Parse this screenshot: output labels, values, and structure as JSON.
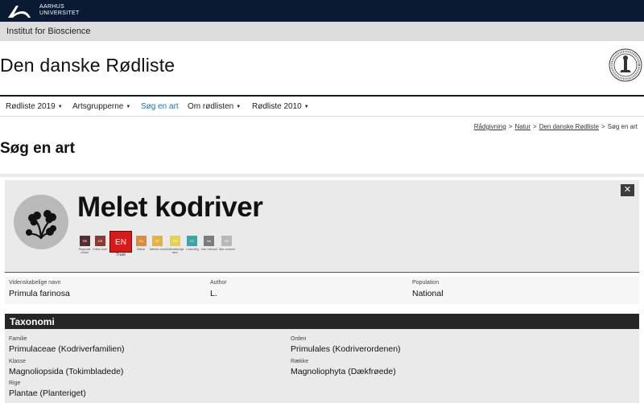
{
  "header": {
    "university_line1": "AARHUS",
    "university_line2": "UNIVERSITET",
    "institute": "Institut for Bioscience",
    "site_title": "Den danske Rødliste"
  },
  "nav": {
    "items": [
      {
        "label": "Rødliste 2019",
        "has_dropdown": true
      },
      {
        "label": "Artsgrupperne",
        "has_dropdown": true
      },
      {
        "label": "Søg en art",
        "active": true
      },
      {
        "label": "Om rødlisten",
        "has_dropdown": true
      },
      {
        "label": "Rødliste 2010",
        "has_dropdown": true
      }
    ],
    "caret": "▼"
  },
  "breadcrumb": {
    "items": [
      "Rådgivning",
      "Natur",
      "Den danske Rødliste"
    ],
    "current": "Søg en art",
    "separator": ">"
  },
  "page_title": "Søg en art",
  "species": {
    "close_label": "✕",
    "name": "Melet kodriver",
    "icon": "plant-sprout-icon",
    "categories": [
      {
        "code": "RE",
        "label": "Regionalt uddød",
        "color": "#5a2e2e"
      },
      {
        "code": "CR",
        "label": "Kritisk truet",
        "color": "#8e3a2e"
      },
      {
        "code": "EN",
        "label": "Truet",
        "color": "#d91a1a",
        "selected": true
      },
      {
        "code": "VU",
        "label": "Sårbar",
        "color": "#e08a3a"
      },
      {
        "code": "NT",
        "label": "Næsten truet",
        "color": "#e8b13a"
      },
      {
        "code": "DD",
        "label": "Utilstrækkelige data",
        "color": "#e8d04a"
      },
      {
        "code": "LC",
        "label": "Livskraftig",
        "color": "#3aa6a8"
      },
      {
        "code": "NA",
        "label": "Ikke relevant",
        "color": "#7b7b7b"
      },
      {
        "code": "NE",
        "label": "Ikke vurderet",
        "color": "#b8b8b8"
      }
    ],
    "facts": [
      {
        "label": "Videnskabelige navn",
        "value": "Primula farinosa"
      },
      {
        "label": "Author",
        "value": "L."
      },
      {
        "label": "Population",
        "value": "National"
      }
    ]
  },
  "taxonomy": {
    "title": "Taxonomi",
    "left": [
      {
        "label": "Familie",
        "value": "Primulaceae (Kodriverfamilien)"
      },
      {
        "label": "Klasse",
        "value": "Magnoliopsida (Tokimbladede)"
      },
      {
        "label": "Rige",
        "value": "Plantae (Planteriget)"
      }
    ],
    "right": [
      {
        "label": "Orden",
        "value": "Primulales (Kodriverordenen)"
      },
      {
        "label": "Række",
        "value": "Magnoliophyta (Dækfrøede)"
      }
    ]
  }
}
